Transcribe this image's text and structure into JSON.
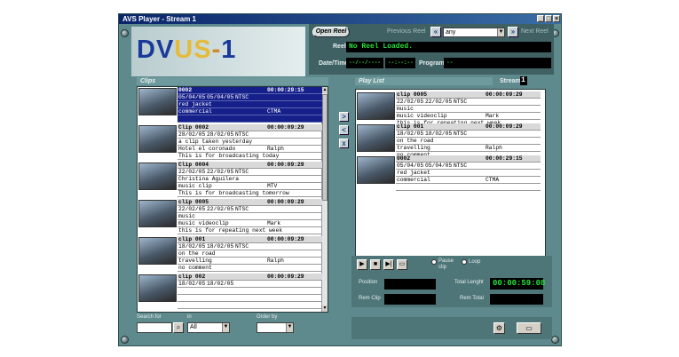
{
  "window": {
    "title": "AVS Player - Stream 1",
    "controls": [
      "_",
      "□",
      "×"
    ]
  },
  "logo": {
    "dv": "DV",
    "us": "US",
    "dash": "-",
    "one": "1"
  },
  "reel": {
    "open_reel_label": "Open Reel",
    "previous_reel_label": "Previous Reel",
    "next_reel_label": "Next Reel",
    "reel_selector_value": "any",
    "reel_label": "Reel",
    "reel_value": "No Reel Loaded.",
    "datetime_label": "Date/Time",
    "date_value": "--/--/----",
    "time_value": "--:--:--",
    "program_label": "Program",
    "program_value": "--"
  },
  "clips": {
    "header": "Clips",
    "items": [
      {
        "id": "0002",
        "tc": "00:00:29:15",
        "d1": "05/04/05",
        "d2": "05/04/05",
        "fmt": "NTSC",
        "title": "red jacket",
        "cat": "commercial",
        "extra": "CTMA",
        "note": "",
        "selected": true
      },
      {
        "id": "Clip 0002",
        "tc": "00:00:09:29",
        "d1": "28/02/05",
        "d2": "28/02/05",
        "fmt": "NTSC",
        "title": "a clip taken yesterday",
        "cat": "Hotel el coronado",
        "extra": "Ralph",
        "note": "This is for broadcasting today",
        "selected": false
      },
      {
        "id": "Clip 0004",
        "tc": "00:00:09:29",
        "d1": "22/02/05",
        "d2": "22/02/05",
        "fmt": "NTSC",
        "title": "Christina Aguilera",
        "cat": "music clip",
        "extra": "MTV",
        "note": "This is for broadcasting tomorrow",
        "selected": false
      },
      {
        "id": "clip 0005",
        "tc": "00:00:09:29",
        "d1": "22/02/05",
        "d2": "22/02/05",
        "fmt": "NTSC",
        "title": "music",
        "cat": "music videoclip",
        "extra": "Mark",
        "note": "this is for repeating next week",
        "selected": false
      },
      {
        "id": "clip 001",
        "tc": "00:00:09:29",
        "d1": "18/02/05",
        "d2": "18/02/05",
        "fmt": "NTSC",
        "title": "on the road",
        "cat": "travelling",
        "extra": "Ralph",
        "note": "no comment",
        "selected": false
      },
      {
        "id": "clip 002",
        "tc": "00:00:09:29",
        "d1": "18/02/05",
        "d2": "18/02/05",
        "fmt": "",
        "title": "",
        "cat": "",
        "extra": "",
        "note": "",
        "selected": false
      }
    ]
  },
  "search": {
    "search_label": "Search for",
    "in_label": "in",
    "in_value": "All",
    "order_label": "Order by",
    "order_value": ""
  },
  "mid_buttons": [
    ">",
    "<",
    "x"
  ],
  "playlist": {
    "header": "Play List",
    "stream_label": "Stream",
    "stream_value": "1",
    "items": [
      {
        "id": "clip 0005",
        "tc": "00:00:09:29",
        "d1": "22/02/05",
        "d2": "22/02/05",
        "fmt": "NTSC",
        "title": "music",
        "cat": "music videoclip",
        "extra": "Mark",
        "note": "this is for repeating next week"
      },
      {
        "id": "clip 001",
        "tc": "00:00:09:29",
        "d1": "18/02/05",
        "d2": "18/02/05",
        "fmt": "NTSC",
        "title": "on the road",
        "cat": "travelling",
        "extra": "Ralph",
        "note": "no comment"
      },
      {
        "id": "0002",
        "tc": "00:00:29:15",
        "d1": "05/04/05",
        "d2": "05/04/05",
        "fmt": "NTSC",
        "title": "red jacket",
        "cat": "commercial",
        "extra": "CTMA",
        "note": ""
      }
    ]
  },
  "transport": {
    "pause_label": "Pause clip",
    "loop_label": "Loop"
  },
  "times": {
    "position_label": "Position",
    "position_value": "",
    "total_label": "Total Lenght",
    "total_value": "00:00:59:08",
    "rem_clip_label": "Rem Clip",
    "rem_clip_value": "",
    "rem_total_label": "Rem Total",
    "rem_total_value": ""
  },
  "colors": {
    "lcd_text": "#28e03c",
    "selected_row": "#16208a",
    "frame": "#5f8a8d"
  }
}
